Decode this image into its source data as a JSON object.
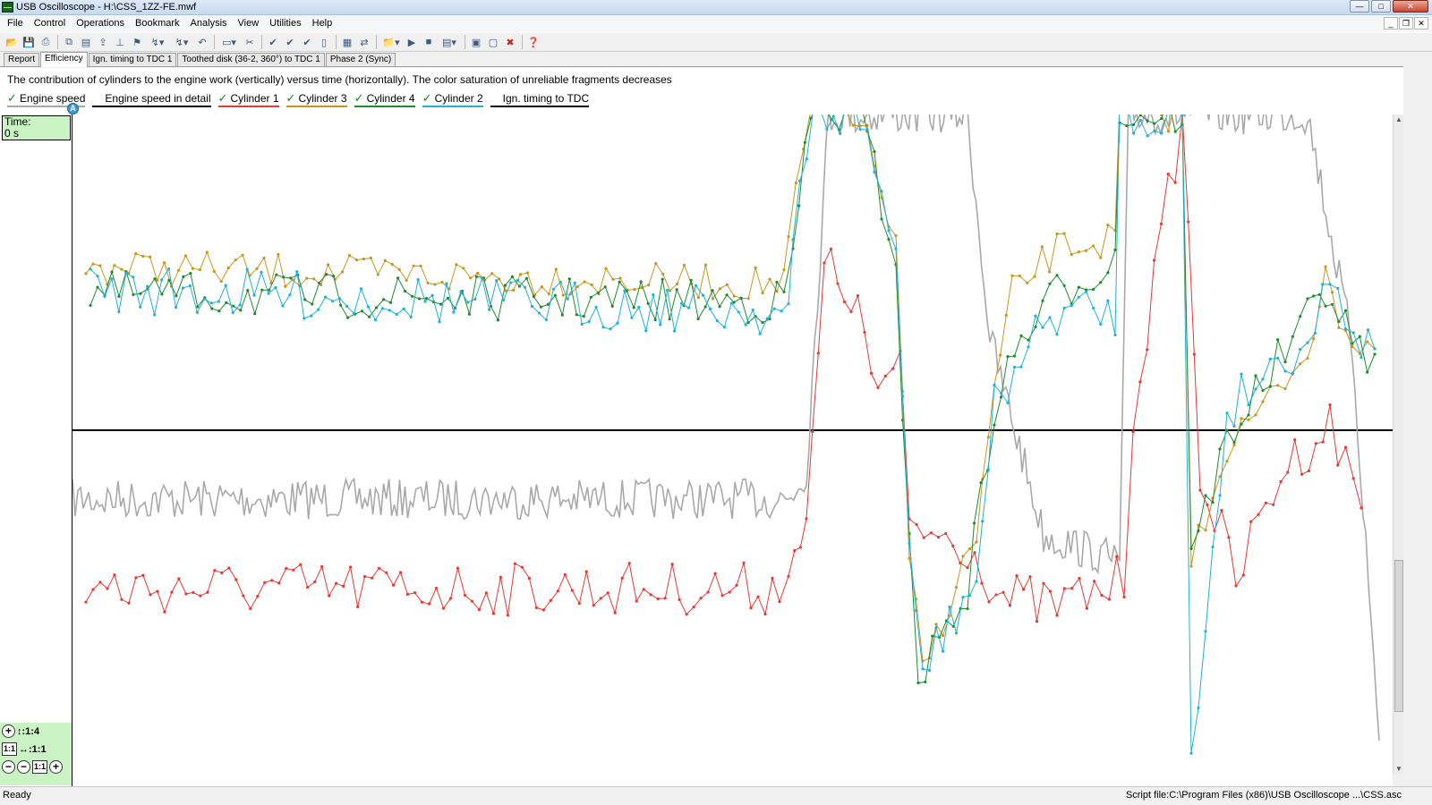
{
  "window": {
    "title": "USB Oscilloscope - H:\\CSS_1ZZ-FE.mwf",
    "minimize": "—",
    "maximize": "□",
    "close": "✕"
  },
  "menu": [
    "File",
    "Control",
    "Operations",
    "Bookmark",
    "Analysis",
    "View",
    "Utilities",
    "Help"
  ],
  "toolbar": {
    "icons": [
      "open-icon",
      "save-icon",
      "print-icon",
      "copy-icon",
      "paste-icon",
      "export-icon",
      "bookmark-icon",
      "cursor-icon",
      "peak-icon",
      "step-back-icon",
      "step-forward-icon",
      "undo-icon",
      "monitor-icon",
      "filter-icon",
      "check-icon",
      "check-double-icon",
      "check-triple-icon",
      "page-icon",
      "grid-icon",
      "transform-icon",
      "folder-icon",
      "play-icon",
      "stop-icon",
      "settings-icon",
      "chart-icon",
      "document-icon",
      "delete-icon",
      "help-icon"
    ]
  },
  "tabs": [
    "Report",
    "Efficiency",
    "Ign. timing to TDC 1",
    "Toothed disk (36-2, 360°) to TDC 1",
    "Phase 2 (Sync)"
  ],
  "active_tab": "Efficiency",
  "description": "The contribution of cylinders to the engine work (vertically) versus time (horizontally). The color saturation of unreliable fragments decreases",
  "legend": [
    {
      "label": "Engine speed",
      "checked": true,
      "color": "#a9a9a9"
    },
    {
      "label": "Engine speed in detail",
      "checked": false,
      "color": "#000000"
    },
    {
      "label": "Cylinder 1",
      "checked": true,
      "color": "#e53935"
    },
    {
      "label": "Cylinder 3",
      "checked": true,
      "color": "#c8961e"
    },
    {
      "label": "Cylinder 4",
      "checked": true,
      "color": "#1e8c2e"
    },
    {
      "label": "Cylinder 2",
      "checked": true,
      "color": "#1fb2d8"
    },
    {
      "label": "Ign. timing to TDC",
      "checked": false,
      "color": "#000000"
    }
  ],
  "cursor_marker": "A",
  "time_box": {
    "label": "Time:",
    "value": "0 s"
  },
  "scale": {
    "vertical": "↕:1:4",
    "horizontal": "↔:1:1",
    "reset_label": "1:1"
  },
  "status": {
    "left": "Ready",
    "right": "Script file:C:\\Program Files (x86)\\USB Oscilloscope ...\\CSS.asc"
  }
}
